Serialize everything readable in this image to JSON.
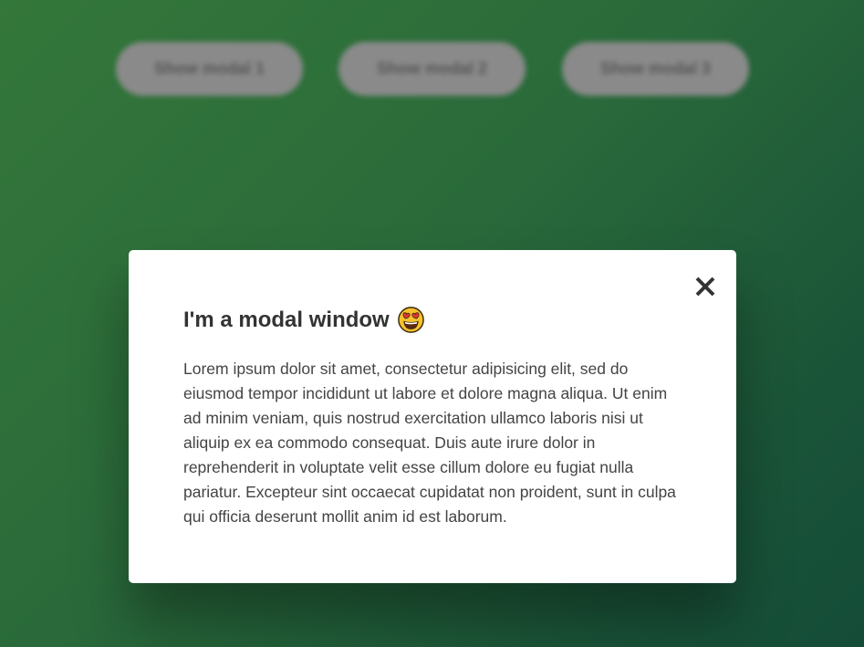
{
  "background": {
    "buttons": [
      {
        "label": "Show modal 1"
      },
      {
        "label": "Show modal 2"
      },
      {
        "label": "Show modal 3"
      }
    ]
  },
  "modal": {
    "title": "I'm a modal window",
    "title_icon": "heart-eyes-emoji-icon",
    "close_icon": "close-icon",
    "body": "Lorem ipsum dolor sit amet, consectetur adipisicing elit, sed do eiusmod tempor incididunt ut labore et dolore magna aliqua. Ut enim ad minim veniam, quis nostrud exercitation ullamco laboris nisi ut aliquip ex ea commodo consequat. Duis aute irure dolor in reprehenderit in voluptate velit esse cillum dolore eu fugiat nulla pariatur. Excepteur sint occaecat cupidatat non proident, sunt in culpa qui officia deserunt mollit anim id est laborum."
  },
  "colors": {
    "background_start": "#34773a",
    "background_end": "#144c38",
    "modal_background": "#ffffff",
    "button_background": "#8a8a8a",
    "title_text": "#333333",
    "body_text": "#444444"
  }
}
